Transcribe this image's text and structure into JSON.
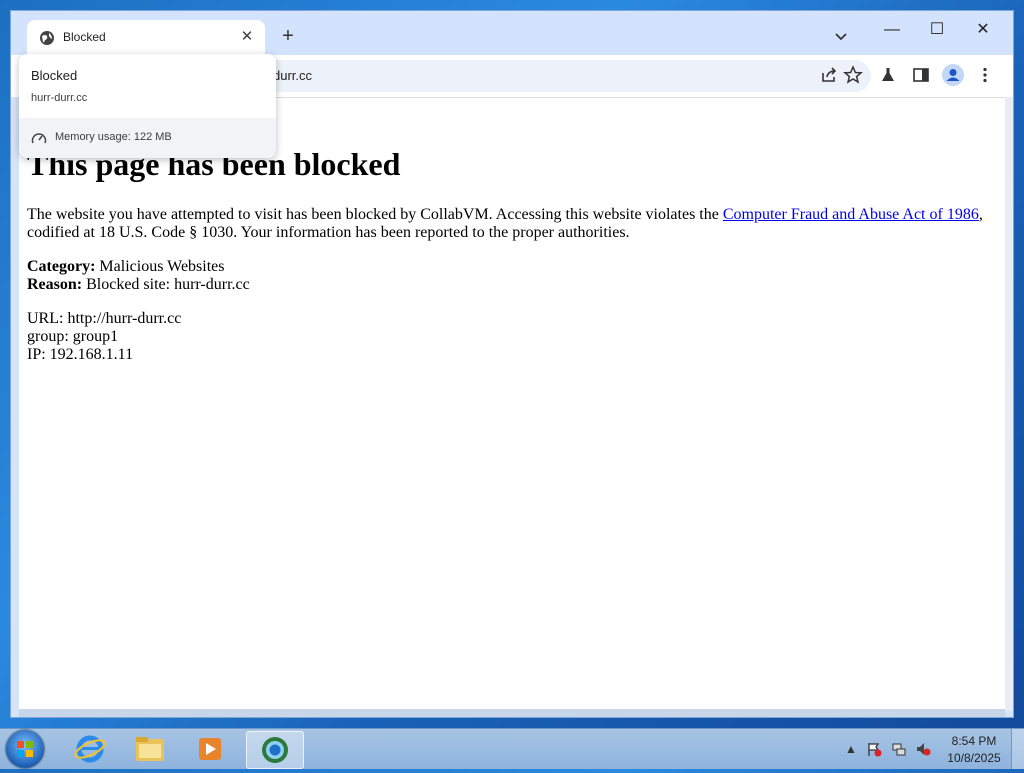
{
  "browser": {
    "tab": {
      "title": "Blocked",
      "close_glyph": "✕"
    },
    "new_tab_glyph": "+",
    "window_controls": {
      "minimize": "—",
      "maximize": "☐",
      "close": "✕"
    },
    "omnibox": {
      "visible_text": "durr.cc"
    },
    "toolbar_icons": [
      "share-icon",
      "bookmark-star-icon",
      "labs-icon",
      "side-panel-icon",
      "profile-icon",
      "menu-icon"
    ]
  },
  "hover_card": {
    "title": "Blocked",
    "domain": "hurr-durr.cc",
    "memory": "Memory usage: 122 MB"
  },
  "page": {
    "heading": "This page has been blocked",
    "intro_before_link": "The website you have attempted to visit has been blocked by CollabVM. Accessing this website violates the ",
    "link_text": "Computer Fraud and Abuse Act of 1986",
    "intro_after_link": ", codified at 18 U.S. Code § 1030. Your information has been reported to the proper authorities.",
    "category_label": "Category:",
    "category_value": " Malicious Websites",
    "reason_label": "Reason:",
    "reason_value": " Blocked site: hurr-durr.cc",
    "url_line": "URL: http://hurr-durr.cc",
    "group_line": "group: group1",
    "ip_line": "IP: 192.168.1.11"
  },
  "taskbar": {
    "pinned": [
      "internet-explorer-icon",
      "file-explorer-icon",
      "media-player-icon",
      "chrome-icon"
    ],
    "tray_up_glyph": "▲",
    "clock": {
      "time": "8:54 PM",
      "date": "10/8/2025"
    }
  },
  "colors": {
    "tabstrip": "#d3e3fd",
    "omnibox": "#edf2fa",
    "link": "#0000ee",
    "taskbar": "#a7c4e4"
  }
}
